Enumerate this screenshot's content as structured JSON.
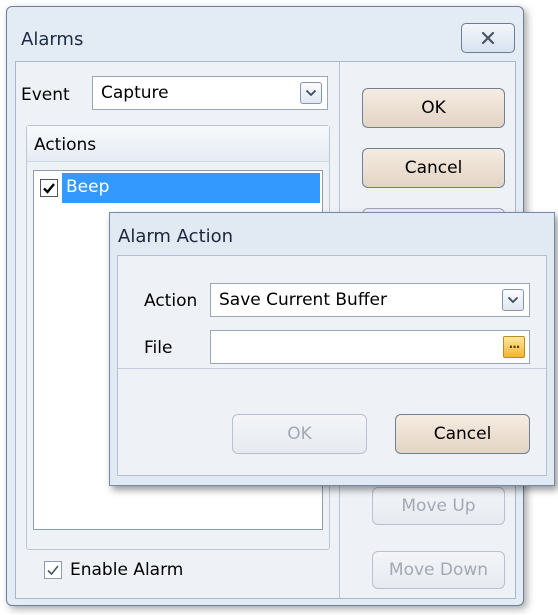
{
  "alarms": {
    "title": "Alarms",
    "event_label": "Event",
    "event_value": "Capture",
    "actions_header": "Actions",
    "actions": [
      {
        "label": "Beep",
        "checked": true,
        "selected": true
      }
    ],
    "enable_alarm_label": "Enable Alarm",
    "enable_alarm_checked": true,
    "buttons": {
      "ok": "OK",
      "cancel": "Cancel",
      "move_up": "Move Up",
      "move_down": "Move Down"
    }
  },
  "alarm_action": {
    "title": "Alarm Action",
    "action_label": "Action",
    "action_value": "Save Current Buffer",
    "file_label": "File",
    "file_value": "",
    "browse_label": "···",
    "buttons": {
      "ok": "OK",
      "cancel": "Cancel"
    }
  },
  "colors": {
    "selection": "#3399ff",
    "window_bg": "#e3ebf4",
    "button_face": "#e8dccf"
  },
  "icons": {
    "close": "close-icon",
    "dropdown": "chevron-down-icon",
    "check": "checkmark-icon",
    "browse": "ellipsis-icon"
  }
}
